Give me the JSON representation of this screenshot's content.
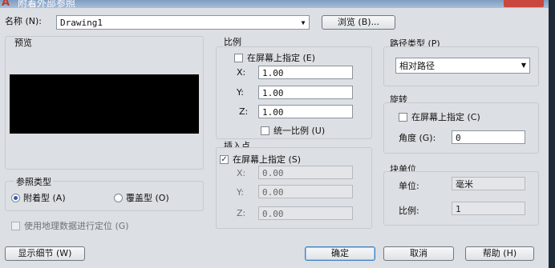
{
  "window": {
    "title": "附着外部参照"
  },
  "name_row": {
    "label": "名称 (N):",
    "value": "Drawing1",
    "browse_label": "浏览 (B)..."
  },
  "preview": {
    "title": "预览"
  },
  "scale": {
    "title": "比例",
    "specify_on_screen": "在屏幕上指定 (E)",
    "x_label": "X:",
    "x_value": "1.00",
    "y_label": "Y:",
    "y_value": "1.00",
    "z_label": "Z:",
    "z_value": "1.00",
    "uniform": "统一比例 (U)"
  },
  "insertion": {
    "title": "插入点",
    "specify_on_screen": "在屏幕上指定 (S)",
    "x_label": "X:",
    "x_value": "0.00",
    "y_label": "Y:",
    "y_value": "0.00",
    "z_label": "Z:",
    "z_value": "0.00"
  },
  "path_type": {
    "title": "路径类型 (P)",
    "value": "相对路径"
  },
  "rotation": {
    "title": "旋转",
    "specify_on_screen": "在屏幕上指定 (C)",
    "angle_label": "角度 (G):",
    "angle_value": "0"
  },
  "block_unit": {
    "title": "块单位",
    "unit_label": "单位:",
    "unit_value": "毫米",
    "factor_label": "比例:",
    "factor_value": "1"
  },
  "reference_type": {
    "title": "参照类型",
    "attachment": "附着型 (A)",
    "overlay": "覆盖型 (O)"
  },
  "geo": {
    "label": "使用地理数据进行定位 (G)"
  },
  "buttons": {
    "details": "显示细节 (W)",
    "ok": "确定",
    "cancel": "取消",
    "help": "帮助 (H)"
  }
}
